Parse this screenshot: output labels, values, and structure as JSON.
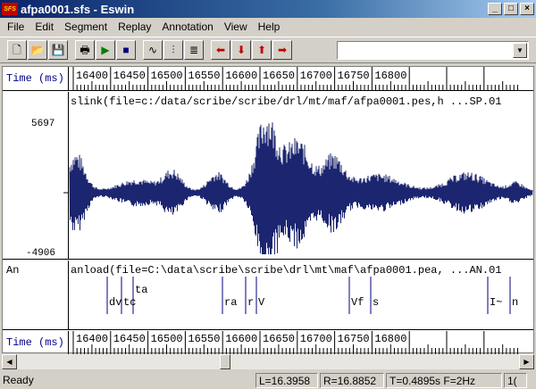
{
  "window": {
    "title": "afpa0001.sfs - Eswin",
    "app_icon_text": "SFS",
    "min_glyph": "_",
    "max_glyph": "□",
    "close_glyph": "×"
  },
  "menu": [
    "File",
    "Edit",
    "Segment",
    "Replay",
    "Annotation",
    "View",
    "Help"
  ],
  "toolbar": {
    "buttons": [
      {
        "name": "new-file",
        "glyph": "🗋"
      },
      {
        "name": "open-folder",
        "glyph": "📂"
      },
      {
        "name": "save-disk",
        "glyph": "💾"
      },
      {
        "name": "print",
        "glyph": "🖶"
      },
      {
        "name": "play",
        "glyph": "▶"
      },
      {
        "name": "stop",
        "glyph": "■"
      },
      {
        "name": "waveform",
        "glyph": "∿"
      },
      {
        "name": "spectrogram-bars",
        "glyph": "⫶"
      },
      {
        "name": "lines",
        "glyph": "≣"
      },
      {
        "name": "arrow-left",
        "glyph": "⬅"
      },
      {
        "name": "arrow-down",
        "glyph": "⬇"
      },
      {
        "name": "arrow-up",
        "glyph": "⬆"
      },
      {
        "name": "arrow-right",
        "glyph": "➡"
      }
    ],
    "combo_value": "",
    "combo_arrow": "▼"
  },
  "ruler": {
    "label": "Time (ms)",
    "ticks": [
      "16400",
      "16450",
      "16500",
      "16550",
      "16600",
      "16650",
      "16700",
      "16750",
      "16800"
    ]
  },
  "wave_pane": {
    "title": "slink(file=c:/data/scribe/scribe/drl/mt/maf/afpa0001.pes,h ...SP.01",
    "ymax": "5697",
    "ymin": "-4906"
  },
  "annot_pane": {
    "track_label": "An",
    "title": "anload(file=C:\\data\\scribe\\scribe\\drl\\mt\\maf\\afpa0001.pea, ...AN.01",
    "labels": [
      "dv",
      "tc",
      "ta",
      "ra",
      "r",
      "V",
      "Vf",
      "s",
      "I~",
      "n"
    ]
  },
  "status": {
    "ready": "Ready",
    "left": "L=16.3958",
    "right": "R=16.8852",
    "span": "T=0.4895s F=2Hz",
    "extra": "1("
  },
  "colors": {
    "wave": "#1c2670",
    "ruler_label": "#00008b"
  }
}
